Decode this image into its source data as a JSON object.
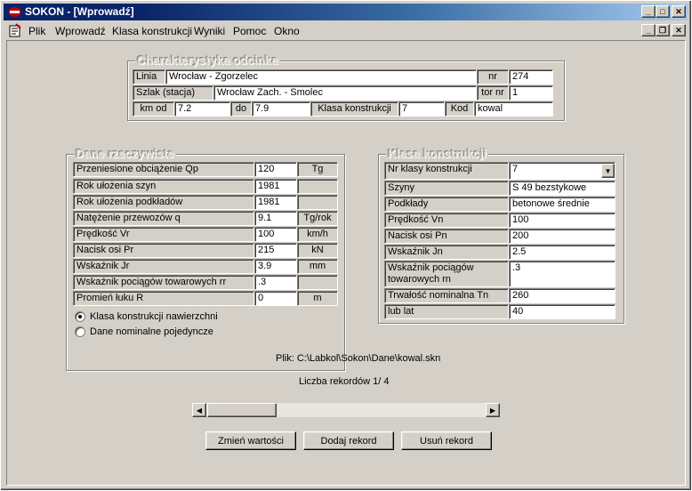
{
  "window": {
    "title": "SOKON - [Wprowadź]"
  },
  "menu": [
    "Plik",
    "Wprowadź",
    "Klasa konstrukcji",
    "Wyniki",
    "Pomoc",
    "Okno"
  ],
  "charakterystyka": {
    "title": "Charakterystyka odcinka",
    "linia_label": "Linia",
    "linia_value": "Wrocław - Zgorzelec",
    "nr_label": "nr",
    "nr_value": "274",
    "szlak_label": "Szlak (stacja)",
    "szlak_value": "Wrocław Zach. - Smolec",
    "tornr_label": "tor nr",
    "tornr_value": "1",
    "kmod_label": "km od",
    "kmod_value": "7.2",
    "do_label": "do",
    "do_value": "7.9",
    "klasa_label": "Klasa konstrukcji",
    "klasa_value": "7",
    "kod_label": "Kod",
    "kod_value": "kowal"
  },
  "dane": {
    "title": "Dane rzeczywiste",
    "rows": [
      {
        "label": "Przeniesione obciążenie Qp",
        "value": "120",
        "unit": "Tg"
      },
      {
        "label": "Rok ułożenia szyn",
        "value": "1981",
        "unit": ""
      },
      {
        "label": "Rok ułożenia podkładów",
        "value": "1981",
        "unit": ""
      },
      {
        "label": "Natężenie przewozów q",
        "value": "9.1",
        "unit": "Tg/rok"
      },
      {
        "label": "Prędkość Vr",
        "value": "100",
        "unit": "km/h"
      },
      {
        "label": "Nacisk osi Pr",
        "value": "215",
        "unit": "kN"
      },
      {
        "label": "Wskaźnik Jr",
        "value": "3.9",
        "unit": "mm"
      },
      {
        "label": "Wskaźnik pociągów towarowych rr",
        "value": ".3",
        "unit": ""
      },
      {
        "label": "Promień łuku R",
        "value": "0",
        "unit": "m"
      }
    ],
    "radio1": "Klasa konstrukcji nawierzchni",
    "radio2": "Dane nominalne pojedyncze"
  },
  "klasa": {
    "title": "Klasa konstrukcji",
    "rows": [
      {
        "label": "Nr klasy konstrukcji",
        "value": "7"
      },
      {
        "label": "Szyny",
        "value": "S 49 bezstykowe"
      },
      {
        "label": "Podkłady",
        "value": "betonowe średnie"
      },
      {
        "label": "Prędkość Vn",
        "value": "100"
      },
      {
        "label": "Nacisk osi Pn",
        "value": "200"
      },
      {
        "label": "Wskaźnik Jn",
        "value": "2.5"
      },
      {
        "label": "Wskaźnik pociągów towarowych rn",
        "value": ".3"
      },
      {
        "label": "Trwałość nominalna Tn",
        "value": "260"
      },
      {
        "label": "lub lat",
        "value": "40"
      }
    ]
  },
  "file_text": "Plik: C:\\Labkol\\Sokon\\Dane\\kowal.skn",
  "records_text": "Liczba rekordów  1/ 4",
  "buttons": {
    "change": "Zmień wartości",
    "add": "Dodaj rekord",
    "delete": "Usuń rekord"
  }
}
